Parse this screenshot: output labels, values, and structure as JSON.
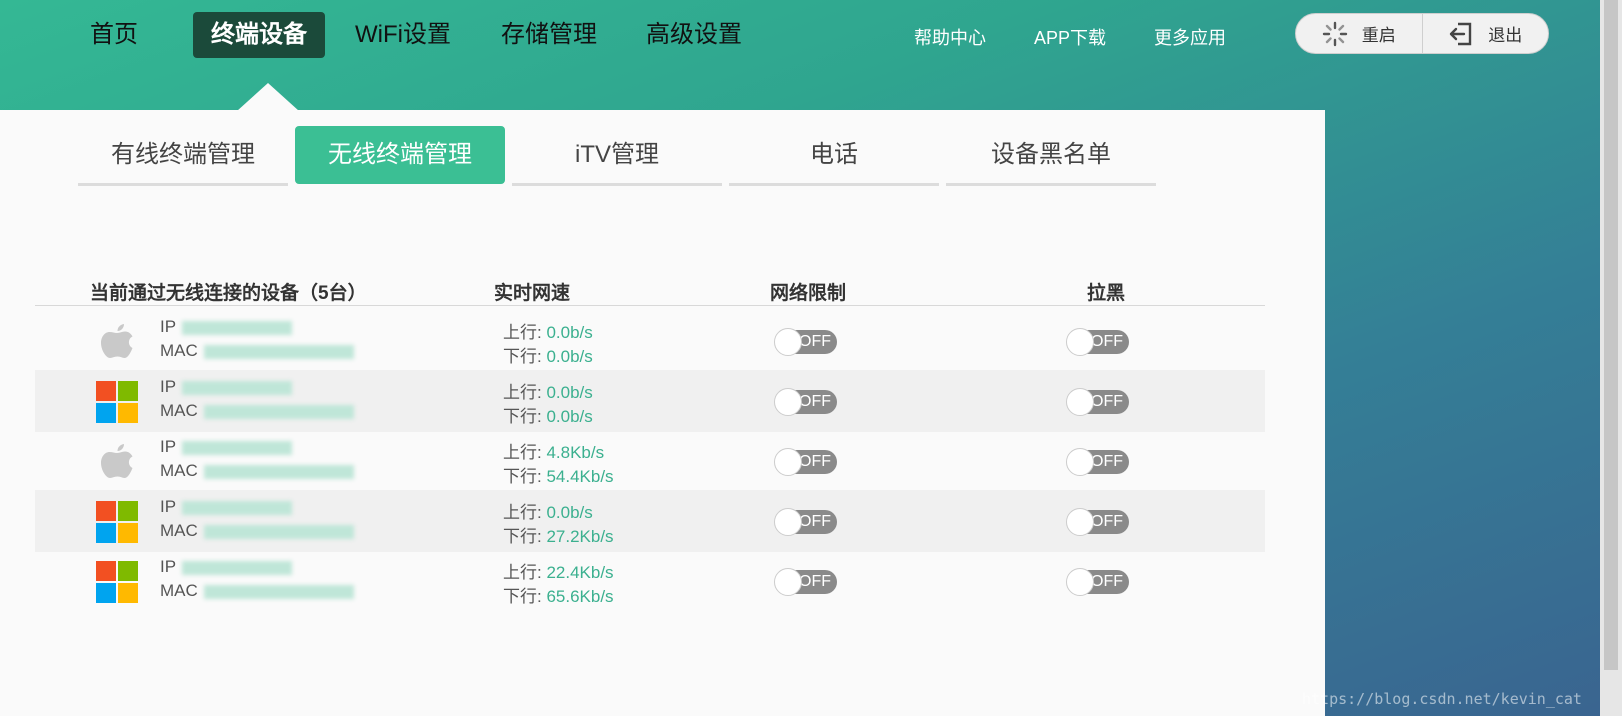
{
  "nav": {
    "items": [
      {
        "label": "首页",
        "active": false
      },
      {
        "label": "终端设备",
        "active": true
      },
      {
        "label": "WiFi设置",
        "active": false
      },
      {
        "label": "存储管理",
        "active": false
      },
      {
        "label": "高级设置",
        "active": false
      }
    ],
    "links": [
      "帮助中心",
      "APP下载",
      "更多应用"
    ],
    "restart_label": "重启",
    "logout_label": "退出"
  },
  "subtabs": [
    {
      "label": "有线终端管理",
      "active": false
    },
    {
      "label": "无线终端管理",
      "active": true
    },
    {
      "label": "iTV管理",
      "active": false
    },
    {
      "label": "电话",
      "active": false
    },
    {
      "label": "设备黑名单",
      "active": false
    }
  ],
  "table": {
    "headers": {
      "devices": "当前通过无线连接的设备（5台）",
      "speed": "实时网速",
      "limit": "网络限制",
      "block": "拉黑"
    },
    "up_prefix": "上行: ",
    "down_prefix": "下行: ",
    "rows": [
      {
        "os": "apple",
        "ip_label": "IP",
        "mac_label": "MAC",
        "up": "0.0b/s",
        "down": "0.0b/s",
        "limit": "OFF",
        "block": "OFF"
      },
      {
        "os": "windows",
        "ip_label": "IP",
        "mac_label": "MAC",
        "up": "0.0b/s",
        "down": "0.0b/s",
        "limit": "OFF",
        "block": "OFF"
      },
      {
        "os": "apple",
        "ip_label": "IP",
        "mac_label": "MAC",
        "up": "4.8Kb/s",
        "down": "54.4Kb/s",
        "limit": "OFF",
        "block": "OFF"
      },
      {
        "os": "windows",
        "ip_label": "IP",
        "mac_label": "MAC",
        "up": "0.0b/s",
        "down": "27.2Kb/s",
        "limit": "OFF",
        "block": "OFF"
      },
      {
        "os": "windows",
        "ip_label": "IP",
        "mac_label": "MAC",
        "up": "22.4Kb/s",
        "down": "65.6Kb/s",
        "limit": "OFF",
        "block": "OFF"
      }
    ]
  },
  "watermark": "https://blog.csdn.net/kevin_cat",
  "colors": {
    "accent": "#3bbf94",
    "nav_active": "#1b4a3a",
    "speed_value": "#3bb08f"
  }
}
